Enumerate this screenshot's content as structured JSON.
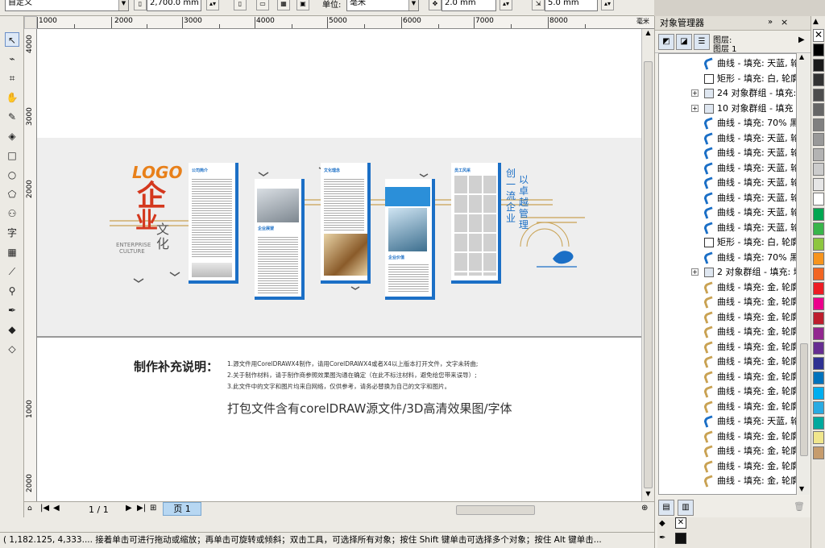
{
  "property_bar": {
    "preset": "自定义",
    "height_value": "2,700.0 mm",
    "unit_label": "单位:",
    "unit_value": "毫米",
    "nudge_value": "2.0 mm",
    "duplicate_value": "5.0 mm"
  },
  "ruler": {
    "h_labels": [
      "1000",
      "2000",
      "3000",
      "4000",
      "5000",
      "6000",
      "7000",
      "8000"
    ],
    "h_unit": "毫米",
    "v_labels": [
      "4000",
      "3000",
      "2000",
      "1000",
      "2000"
    ]
  },
  "design": {
    "logo": "LOGO",
    "big_char_1": "企",
    "big_char_2": "业",
    "culture_word": "文化",
    "english_1": "ENTERPRISE",
    "english_2": "CULTURE",
    "panel_1_title": "公司简介",
    "panel_2_title": "企业展望",
    "panel_3_title": "文化理念",
    "panel_4_title": "企业价值",
    "panel_5_title": "员工风采",
    "slogan_1": "创一流企业",
    "slogan_2": "以卓越管理",
    "note_title": "制作补充说明：",
    "note_lines": [
      "1.源文件用CorelDRAWX4制作，请用CorelDRAWX4或者X4以上版本打开文件，文字未转曲;",
      "2.关于制作材料，请于制作商参照效果图沟通在确定（在此不标注材料，避免给您带来误导）;",
      "3.此文件中的文字和图片均来自网络，仅供参考，请务必替换为自己的文字和图片。"
    ],
    "package_note": "打包文件含有corelDRAW源文件/3D高清效果图/字体"
  },
  "page_nav": {
    "page_count": "1 / 1",
    "page_tab": "页 1"
  },
  "status_bar": {
    "text": "( 1,182.125, 4,333....   接着单击可进行拖动或缩放；再单击可旋转或倾斜；双击工具，可选择所有对象；按住 Shift 键单击可选择多个对象；按住 Alt 键单击..."
  },
  "object_manager": {
    "title": "对象管理器",
    "layer_label": "图层:",
    "layer_name": "图层 1",
    "rows": [
      {
        "text": "曲线 - 填充: 天蓝, 轮",
        "icon": "curve-blue-icon",
        "group": false
      },
      {
        "text": "矩形 - 填充: 白, 轮廓",
        "icon": "rectangle-icon",
        "group": false
      },
      {
        "text": "24 对象群组 - 填充:",
        "icon": "group-icon",
        "group": true
      },
      {
        "text": "10 对象群组 - 填充",
        "icon": "group-icon",
        "group": true
      },
      {
        "text": "曲线 - 填充: 70% 黑",
        "icon": "curve-blue-icon",
        "group": false
      },
      {
        "text": "曲线 - 填充: 天蓝, 轮",
        "icon": "curve-blue-icon",
        "group": false
      },
      {
        "text": "曲线 - 填充: 天蓝, 轮",
        "icon": "curve-blue-icon",
        "group": false
      },
      {
        "text": "曲线 - 填充: 天蓝, 轮",
        "icon": "curve-blue-icon",
        "group": false
      },
      {
        "text": "曲线 - 填充: 天蓝, 轮",
        "icon": "curve-blue-icon",
        "group": false
      },
      {
        "text": "曲线 - 填充: 天蓝, 轮",
        "icon": "curve-blue-icon",
        "group": false
      },
      {
        "text": "曲线 - 填充: 天蓝, 轮",
        "icon": "curve-blue-icon",
        "group": false
      },
      {
        "text": "曲线 - 填充: 天蓝, 轮",
        "icon": "curve-blue-icon",
        "group": false
      },
      {
        "text": "矩形 - 填充: 白, 轮廓",
        "icon": "rectangle-icon",
        "group": false
      },
      {
        "text": "曲线 - 填充: 70% 黑",
        "icon": "curve-blue-icon",
        "group": false
      },
      {
        "text": "2 对象群组 - 填充: 均",
        "icon": "group-icon",
        "group": true
      },
      {
        "text": "曲线 - 填充: 金, 轮廓",
        "icon": "curve-gold-icon",
        "group": false
      },
      {
        "text": "曲线 - 填充: 金, 轮廓",
        "icon": "curve-gold-icon",
        "group": false
      },
      {
        "text": "曲线 - 填充: 金, 轮廓",
        "icon": "curve-gold-icon",
        "group": false
      },
      {
        "text": "曲线 - 填充: 金, 轮廓",
        "icon": "curve-gold-icon",
        "group": false
      },
      {
        "text": "曲线 - 填充: 金, 轮廓",
        "icon": "curve-gold-icon",
        "group": false
      },
      {
        "text": "曲线 - 填充: 金, 轮廓",
        "icon": "curve-gold-icon",
        "group": false
      },
      {
        "text": "曲线 - 填充: 金, 轮廓",
        "icon": "curve-gold-icon",
        "group": false
      },
      {
        "text": "曲线 - 填充: 金, 轮廓",
        "icon": "curve-gold-icon",
        "group": false
      },
      {
        "text": "曲线 - 填充: 金, 轮廓",
        "icon": "curve-gold-icon",
        "group": false
      },
      {
        "text": "曲线 - 填充: 天蓝, 轮",
        "icon": "curve-blue-icon",
        "group": false
      },
      {
        "text": "曲线 - 填充: 金, 轮廓",
        "icon": "curve-gold-icon",
        "group": false
      },
      {
        "text": "曲线 - 填充: 金, 轮廓",
        "icon": "curve-gold-icon",
        "group": false
      },
      {
        "text": "曲线 - 填充: 金, 轮廓",
        "icon": "curve-gold-icon",
        "group": false
      },
      {
        "text": "曲线 - 填充: 金, 轮廓",
        "icon": "curve-gold-icon",
        "group": false
      }
    ]
  },
  "colors": {
    "accent_blue": "#1b6fc6",
    "logo_orange": "#e8801a",
    "brand_red": "#d4381e",
    "gold": "#c9a253",
    "palette": [
      "#000000",
      "#1a1a1a",
      "#333333",
      "#4d4d4d",
      "#666666",
      "#808080",
      "#999999",
      "#b3b3b3",
      "#cccccc",
      "#e6e6e6",
      "#ffffff",
      "#00a651",
      "#39b54a",
      "#8dc63f",
      "#f7941d",
      "#f26522",
      "#ed1c24",
      "#ec008c",
      "#be1e2d",
      "#92278f",
      "#662d91",
      "#2e3192",
      "#0072bc",
      "#00aeef",
      "#29abe2",
      "#00a99d",
      "#f0e68c",
      "#c69c6d"
    ]
  }
}
